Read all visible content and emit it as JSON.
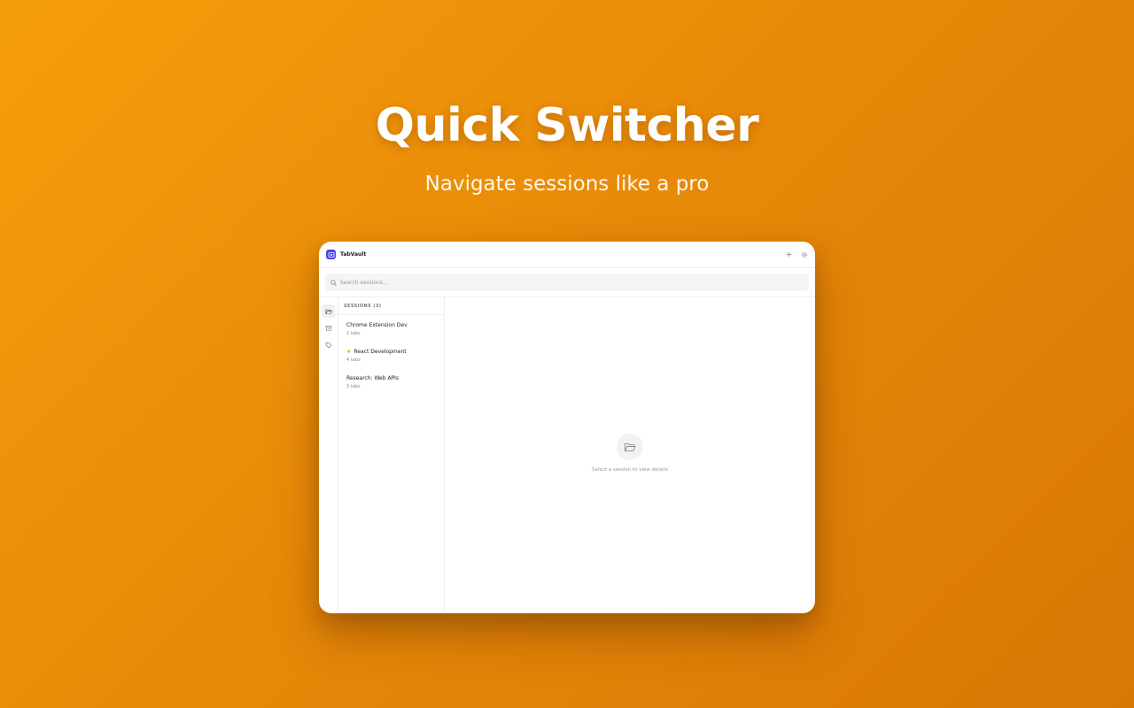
{
  "hero": {
    "title": "Quick Switcher",
    "subtitle": "Navigate sessions like a pro"
  },
  "app": {
    "name": "TabVault",
    "logo_icon": "vault-icon",
    "accent_color": "#4f46e5",
    "header_actions": [
      {
        "icon": "plus-icon"
      },
      {
        "icon": "gear-icon"
      }
    ],
    "search": {
      "placeholder": "Search sessions..."
    },
    "rail": [
      {
        "icon": "folder-open-icon",
        "active": true
      },
      {
        "icon": "archive-icon",
        "active": false
      },
      {
        "icon": "tag-icon",
        "active": false
      }
    ],
    "sessions_header": "SESSIONS (3)",
    "sessions": [
      {
        "title": "Chrome Extension Dev",
        "count": "2 tabs",
        "starred": false
      },
      {
        "title": "React Development",
        "count": "4 tabs",
        "starred": true
      },
      {
        "title": "Research: Web APIs",
        "count": "3 tabs",
        "starred": false
      }
    ],
    "empty_state": {
      "icon": "folder-open-icon",
      "text": "Select a session to view details"
    }
  }
}
